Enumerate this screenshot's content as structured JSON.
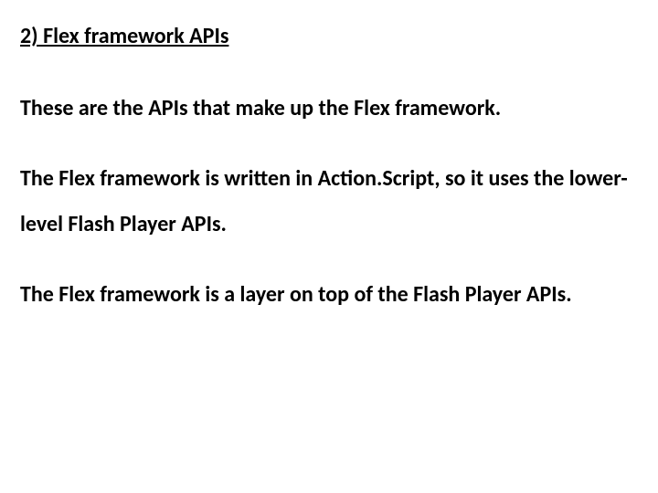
{
  "heading": "2) Flex framework APIs",
  "paragraphs": {
    "p1": "These are the APIs that make up the Flex framework.",
    "p2": "The Flex framework is written in Action.Script, so it uses the lower-level Flash Player APIs.",
    "p3": "The Flex framework is a layer on top of the Flash Player APIs."
  }
}
